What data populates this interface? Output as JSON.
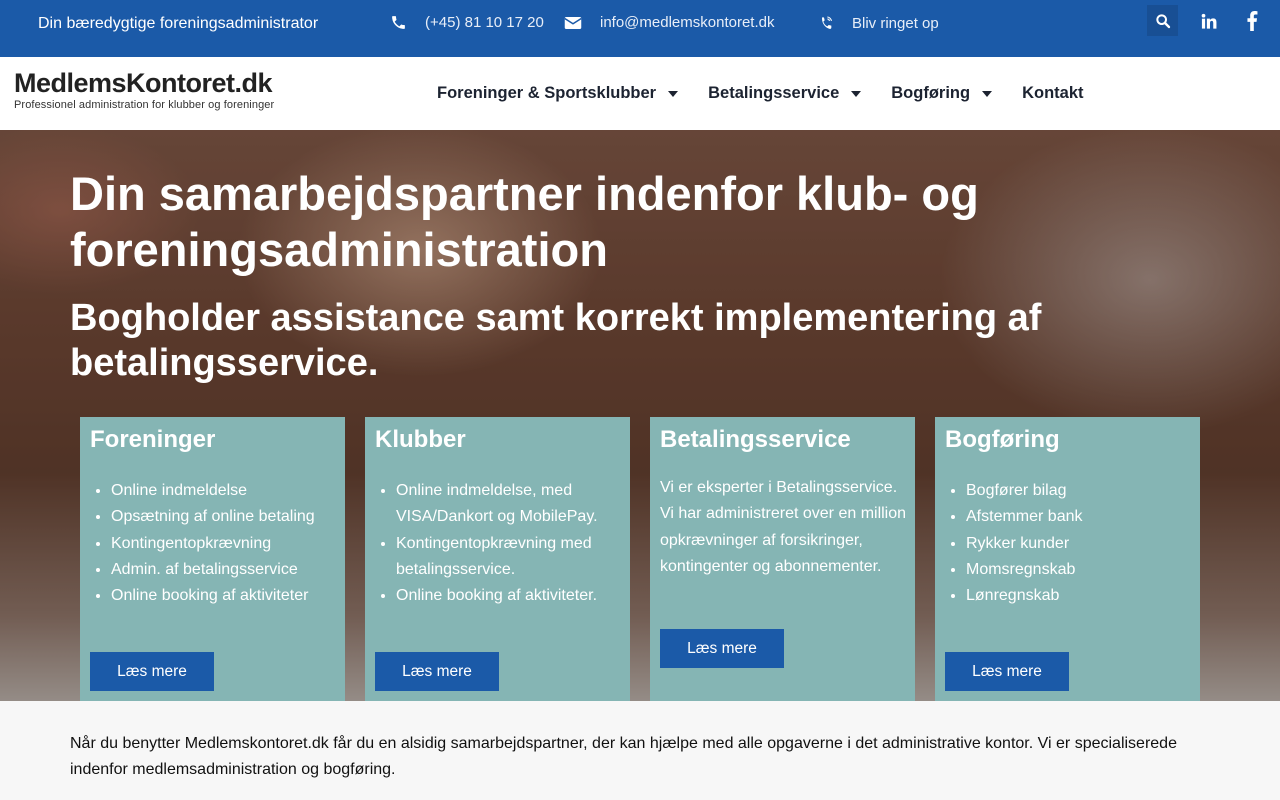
{
  "topbar": {
    "tagline": "Din bæredygtige foreningsadministrator",
    "phone": "(+45) 81 10 17 20",
    "email": "info@medlemskontoret.dk",
    "callback": "Bliv ringet op",
    "icons": [
      "phone-icon",
      "envelope-icon",
      "phone-volume-icon",
      "search-icon",
      "linkedin-icon",
      "facebook-icon"
    ]
  },
  "header": {
    "logo_main": "MedlemsKontoret.dk",
    "logo_sub": "Professionel administration for klubber og foreninger",
    "nav": [
      {
        "label": "Foreninger & Sportsklubber"
      },
      {
        "label": "Betalingsservice"
      },
      {
        "label": "Bogføring"
      },
      {
        "label": "Kontakt"
      }
    ]
  },
  "hero": {
    "title": "Din samarbejdspartner indenfor klub- og foreningsadministration",
    "subtitle": "Bogholder assistance samt korrekt implementering af betalingsservice."
  },
  "cards": [
    {
      "title": "Foreninger",
      "items": [
        "Online indmeldelse",
        "Opsætning af online betaling",
        "Kontingentopkrævning",
        "Admin. af betalingsservice",
        "Online booking af aktiviteter"
      ],
      "button": "Læs mere"
    },
    {
      "title": "Klubber",
      "items": [
        "Online indmeldelse, med VISA/Dankort og MobilePay.",
        "Kontingentopkrævning med betalingsservice.",
        "Online booking af aktiviteter."
      ],
      "button": "Læs mere"
    },
    {
      "title": "Betalingsservice",
      "text": "Vi er eksperter i Betalingsservice. Vi har administreret over en million opkrævninger af forsikringer, kontingenter og abonnementer.",
      "button": "Læs mere"
    },
    {
      "title": "Bogføring",
      "items": [
        "Bogfører bilag",
        "Afstemmer bank",
        "Rykker kunder",
        "Momsregnskab",
        "Lønregnskab"
      ],
      "button": "Læs mere"
    }
  ],
  "intro": "Når du benytter Medlemskontoret.dk får du en alsidig samarbejdspartner, der kan hjælpe med alle opgaverne i det administrative kontor. Vi er specialiserede indenfor medlemsadministration og bogføring.",
  "colors": {
    "brand": "#1b5aa8",
    "card": "#85b5b4"
  }
}
